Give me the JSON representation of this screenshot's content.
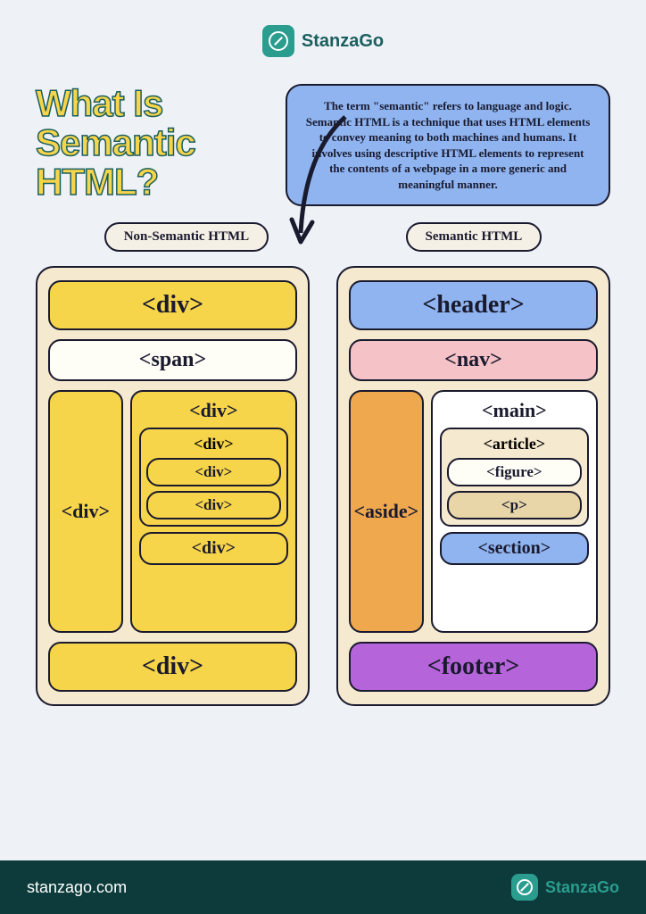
{
  "brand": {
    "name": "StanzaGo",
    "url": "stanzago.com"
  },
  "title": "What Is Semantic HTML?",
  "description": "The term \"semantic\" refers to language and logic. Semantic HTML is a technique that uses HTML elements to convey meaning to both machines and humans. It involves using descriptive HTML elements to represent the contents of a webpage in a more generic and meaningful manner.",
  "labels": {
    "nonsemantic": "Non-Semantic HTML",
    "semantic": "Semantic HTML"
  },
  "nonsemantic": {
    "top": "<div>",
    "span": "<span>",
    "side": "<div>",
    "group_title": "<div>",
    "inner_title": "<div>",
    "inner1": "<div>",
    "inner2": "<div>",
    "group_bottom": "<div>",
    "bottom": "<div>"
  },
  "semantic": {
    "header": "<header>",
    "nav": "<nav>",
    "aside": "<aside>",
    "main": "<main>",
    "article": "<article>",
    "figure": "<figure>",
    "p": "<p>",
    "section": "<section>",
    "footer": "<footer>"
  }
}
